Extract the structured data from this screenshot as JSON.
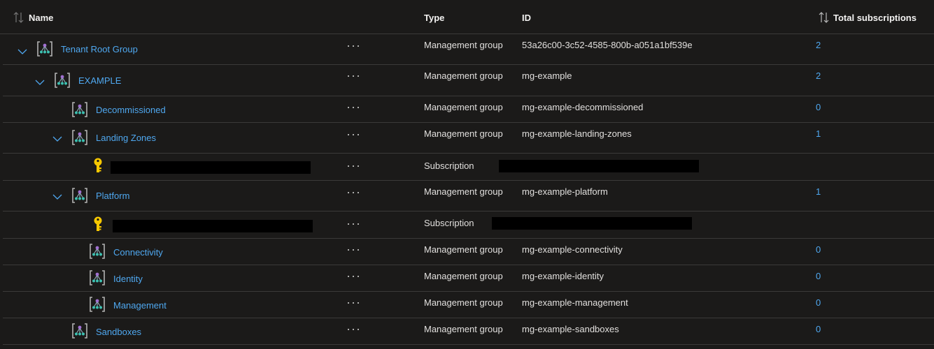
{
  "columns": {
    "name": "Name",
    "type": "Type",
    "id": "ID",
    "total_subscriptions": "Total subscriptions"
  },
  "icons": {
    "sort": "sort-icon",
    "expand": "chevron-down-icon",
    "management_group": "management-group-icon",
    "subscription": "key-icon",
    "more": "ellipsis-icon"
  },
  "colors": {
    "background": "#1b1a19",
    "link": "#4fa8f0",
    "text": "#dcdcdc",
    "divider": "#3b3a39",
    "key": "#f7c800"
  },
  "rows": [
    {
      "name": "Tenant Root Group",
      "type": "Management group",
      "id": "53a26c00-3c52-4585-800b-a051a1bf539e",
      "count": "2"
    },
    {
      "name": "EXAMPLE",
      "type": "Management group",
      "id": "mg-example",
      "count": "2"
    },
    {
      "name": "Decommissioned",
      "type": "Management group",
      "id": "mg-example-decommissioned",
      "count": "0"
    },
    {
      "name": "Landing Zones",
      "type": "Management group",
      "id": "mg-example-landing-zones",
      "count": "1"
    },
    {
      "name": "",
      "type": "Subscription",
      "id": "",
      "count": ""
    },
    {
      "name": "Platform",
      "type": "Management group",
      "id": "mg-example-platform",
      "count": "1"
    },
    {
      "name": "",
      "type": "Subscription",
      "id": "",
      "count": ""
    },
    {
      "name": "Connectivity",
      "type": "Management group",
      "id": "mg-example-connectivity",
      "count": "0"
    },
    {
      "name": "Identity",
      "type": "Management group",
      "id": "mg-example-identity",
      "count": "0"
    },
    {
      "name": "Management",
      "type": "Management group",
      "id": "mg-example-management",
      "count": "0"
    },
    {
      "name": "Sandboxes",
      "type": "Management group",
      "id": "mg-example-sandboxes",
      "count": "0"
    }
  ]
}
